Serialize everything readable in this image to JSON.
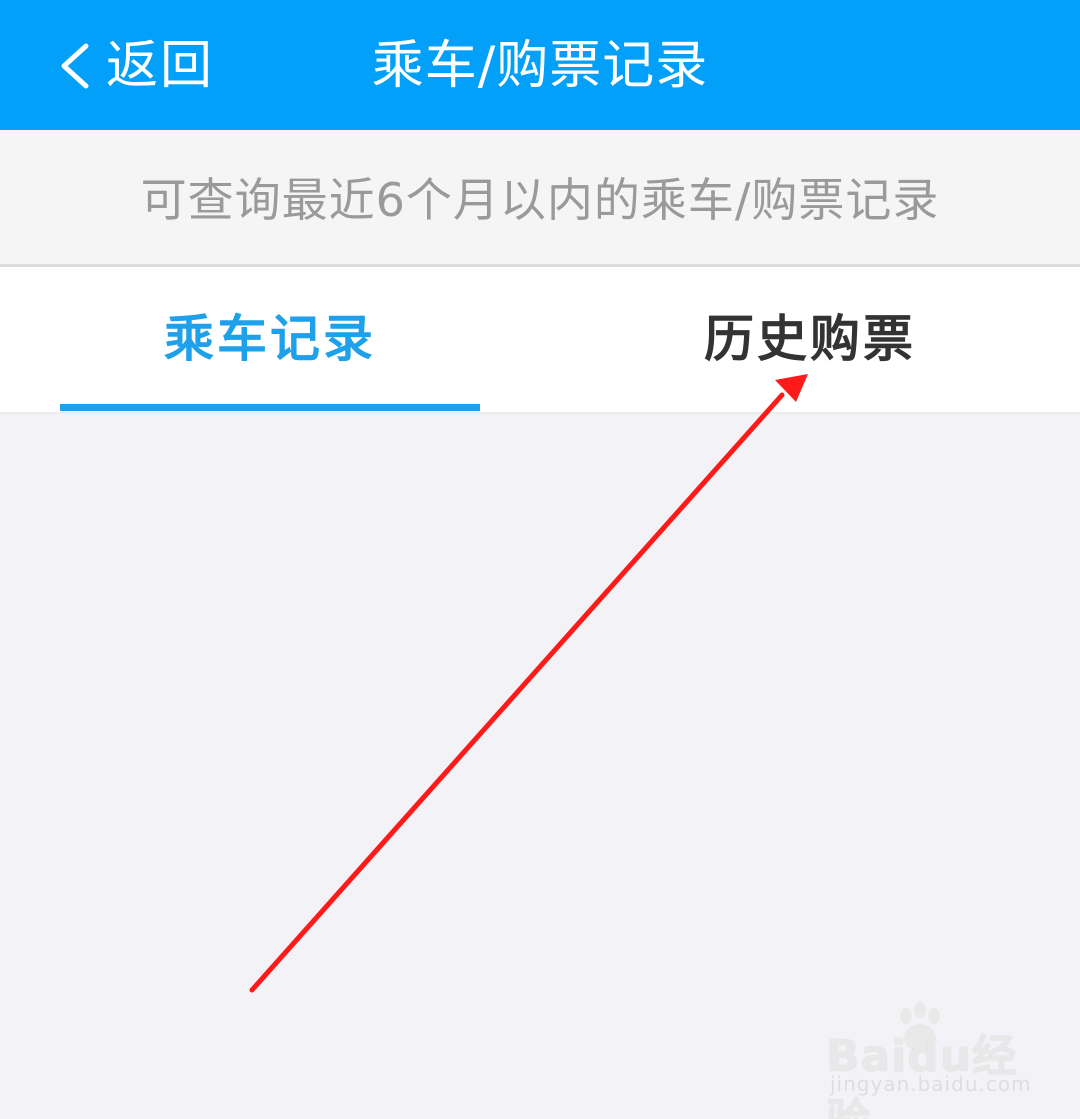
{
  "header": {
    "back_label": "返回",
    "title": "乘车/购票记录",
    "background_color": "#02a0f9"
  },
  "notice": {
    "text": "可查询最近6个月以内的乘车/购票记录"
  },
  "tabs": [
    {
      "label": "乘车记录",
      "active": true
    },
    {
      "label": "历史购票",
      "active": false
    }
  ],
  "colors": {
    "accent": "#1ea0ea",
    "annotation_arrow": "#ff1a1a",
    "page_background": "#f3f3f7"
  },
  "watermark": {
    "logo_text": "Baidu经验",
    "url": "jingyan.baidu.com"
  }
}
